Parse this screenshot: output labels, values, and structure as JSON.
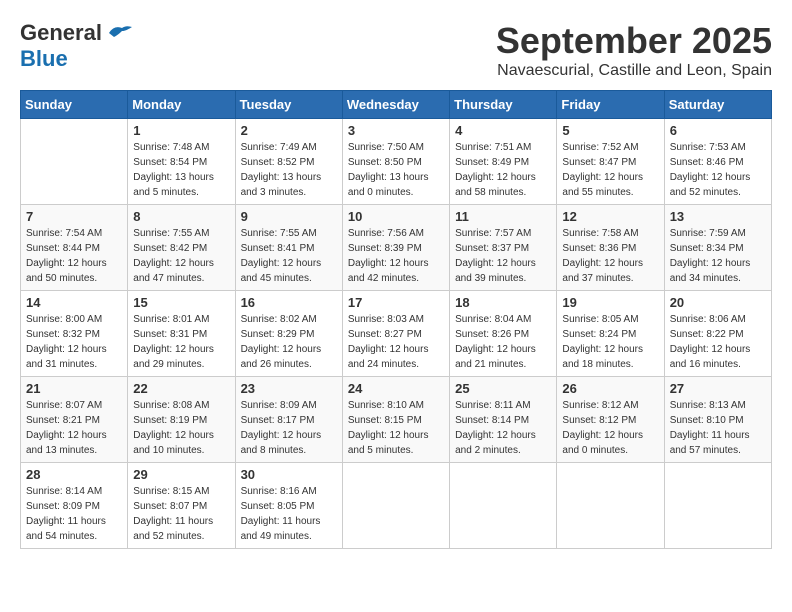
{
  "logo": {
    "general": "General",
    "blue": "Blue"
  },
  "header": {
    "month": "September 2025",
    "location": "Navaescurial, Castille and Leon, Spain"
  },
  "weekdays": [
    "Sunday",
    "Monday",
    "Tuesday",
    "Wednesday",
    "Thursday",
    "Friday",
    "Saturday"
  ],
  "weeks": [
    [
      {
        "day": "",
        "info": ""
      },
      {
        "day": "1",
        "info": "Sunrise: 7:48 AM\nSunset: 8:54 PM\nDaylight: 13 hours\nand 5 minutes."
      },
      {
        "day": "2",
        "info": "Sunrise: 7:49 AM\nSunset: 8:52 PM\nDaylight: 13 hours\nand 3 minutes."
      },
      {
        "day": "3",
        "info": "Sunrise: 7:50 AM\nSunset: 8:50 PM\nDaylight: 13 hours\nand 0 minutes."
      },
      {
        "day": "4",
        "info": "Sunrise: 7:51 AM\nSunset: 8:49 PM\nDaylight: 12 hours\nand 58 minutes."
      },
      {
        "day": "5",
        "info": "Sunrise: 7:52 AM\nSunset: 8:47 PM\nDaylight: 12 hours\nand 55 minutes."
      },
      {
        "day": "6",
        "info": "Sunrise: 7:53 AM\nSunset: 8:46 PM\nDaylight: 12 hours\nand 52 minutes."
      }
    ],
    [
      {
        "day": "7",
        "info": "Sunrise: 7:54 AM\nSunset: 8:44 PM\nDaylight: 12 hours\nand 50 minutes."
      },
      {
        "day": "8",
        "info": "Sunrise: 7:55 AM\nSunset: 8:42 PM\nDaylight: 12 hours\nand 47 minutes."
      },
      {
        "day": "9",
        "info": "Sunrise: 7:55 AM\nSunset: 8:41 PM\nDaylight: 12 hours\nand 45 minutes."
      },
      {
        "day": "10",
        "info": "Sunrise: 7:56 AM\nSunset: 8:39 PM\nDaylight: 12 hours\nand 42 minutes."
      },
      {
        "day": "11",
        "info": "Sunrise: 7:57 AM\nSunset: 8:37 PM\nDaylight: 12 hours\nand 39 minutes."
      },
      {
        "day": "12",
        "info": "Sunrise: 7:58 AM\nSunset: 8:36 PM\nDaylight: 12 hours\nand 37 minutes."
      },
      {
        "day": "13",
        "info": "Sunrise: 7:59 AM\nSunset: 8:34 PM\nDaylight: 12 hours\nand 34 minutes."
      }
    ],
    [
      {
        "day": "14",
        "info": "Sunrise: 8:00 AM\nSunset: 8:32 PM\nDaylight: 12 hours\nand 31 minutes."
      },
      {
        "day": "15",
        "info": "Sunrise: 8:01 AM\nSunset: 8:31 PM\nDaylight: 12 hours\nand 29 minutes."
      },
      {
        "day": "16",
        "info": "Sunrise: 8:02 AM\nSunset: 8:29 PM\nDaylight: 12 hours\nand 26 minutes."
      },
      {
        "day": "17",
        "info": "Sunrise: 8:03 AM\nSunset: 8:27 PM\nDaylight: 12 hours\nand 24 minutes."
      },
      {
        "day": "18",
        "info": "Sunrise: 8:04 AM\nSunset: 8:26 PM\nDaylight: 12 hours\nand 21 minutes."
      },
      {
        "day": "19",
        "info": "Sunrise: 8:05 AM\nSunset: 8:24 PM\nDaylight: 12 hours\nand 18 minutes."
      },
      {
        "day": "20",
        "info": "Sunrise: 8:06 AM\nSunset: 8:22 PM\nDaylight: 12 hours\nand 16 minutes."
      }
    ],
    [
      {
        "day": "21",
        "info": "Sunrise: 8:07 AM\nSunset: 8:21 PM\nDaylight: 12 hours\nand 13 minutes."
      },
      {
        "day": "22",
        "info": "Sunrise: 8:08 AM\nSunset: 8:19 PM\nDaylight: 12 hours\nand 10 minutes."
      },
      {
        "day": "23",
        "info": "Sunrise: 8:09 AM\nSunset: 8:17 PM\nDaylight: 12 hours\nand 8 minutes."
      },
      {
        "day": "24",
        "info": "Sunrise: 8:10 AM\nSunset: 8:15 PM\nDaylight: 12 hours\nand 5 minutes."
      },
      {
        "day": "25",
        "info": "Sunrise: 8:11 AM\nSunset: 8:14 PM\nDaylight: 12 hours\nand 2 minutes."
      },
      {
        "day": "26",
        "info": "Sunrise: 8:12 AM\nSunset: 8:12 PM\nDaylight: 12 hours\nand 0 minutes."
      },
      {
        "day": "27",
        "info": "Sunrise: 8:13 AM\nSunset: 8:10 PM\nDaylight: 11 hours\nand 57 minutes."
      }
    ],
    [
      {
        "day": "28",
        "info": "Sunrise: 8:14 AM\nSunset: 8:09 PM\nDaylight: 11 hours\nand 54 minutes."
      },
      {
        "day": "29",
        "info": "Sunrise: 8:15 AM\nSunset: 8:07 PM\nDaylight: 11 hours\nand 52 minutes."
      },
      {
        "day": "30",
        "info": "Sunrise: 8:16 AM\nSunset: 8:05 PM\nDaylight: 11 hours\nand 49 minutes."
      },
      {
        "day": "",
        "info": ""
      },
      {
        "day": "",
        "info": ""
      },
      {
        "day": "",
        "info": ""
      },
      {
        "day": "",
        "info": ""
      }
    ]
  ]
}
